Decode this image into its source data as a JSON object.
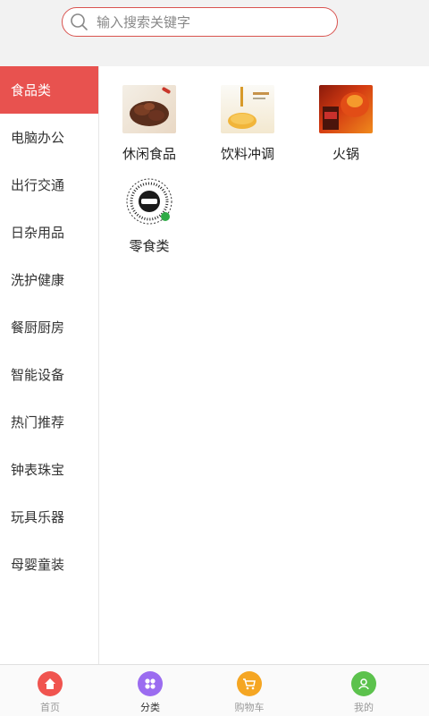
{
  "search": {
    "placeholder": "输入搜索关键字"
  },
  "sidebar": {
    "items": [
      {
        "label": "食品类",
        "active": true
      },
      {
        "label": "电脑办公"
      },
      {
        "label": "出行交通"
      },
      {
        "label": "日杂用品"
      },
      {
        "label": "洗护健康"
      },
      {
        "label": "餐厨厨房"
      },
      {
        "label": "智能设备"
      },
      {
        "label": "热门推荐"
      },
      {
        "label": "钟表珠宝"
      },
      {
        "label": "玩具乐器"
      },
      {
        "label": "母婴童装"
      }
    ]
  },
  "categories": [
    {
      "label": "休闲食品",
      "image": "snack-food-image"
    },
    {
      "label": "饮料冲调",
      "image": "honey-drink-image"
    },
    {
      "label": "火锅",
      "image": "hotpot-sauce-image"
    },
    {
      "label": "零食类",
      "image": "qr-code-image"
    }
  ],
  "tabbar": {
    "items": [
      {
        "label": "首页",
        "icon": "home-icon",
        "color": "#f0544f"
      },
      {
        "label": "分类",
        "icon": "category-icon",
        "color": "#9b6cf0",
        "active": true
      },
      {
        "label": "购物车",
        "icon": "cart-icon",
        "color": "#f5a623"
      },
      {
        "label": "我的",
        "icon": "user-icon",
        "color": "#5cc24d"
      }
    ]
  },
  "colors": {
    "accent": "#e8524f",
    "header_bg": "#f2f2f2"
  }
}
